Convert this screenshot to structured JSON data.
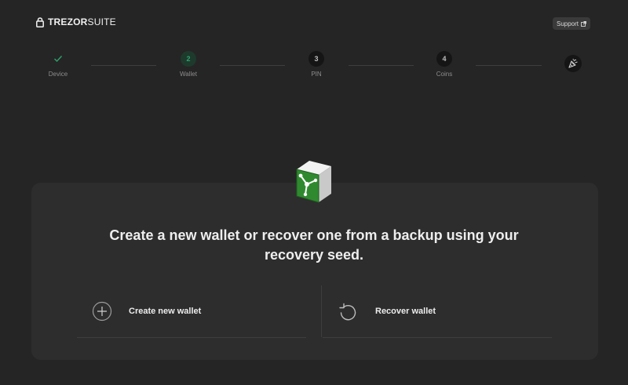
{
  "app": {
    "logo_bold": "TREZOR",
    "logo_light": "SUITE",
    "support_label": "Support"
  },
  "stepper": {
    "steps": [
      {
        "label": "Device",
        "number": "",
        "state": "done"
      },
      {
        "label": "Wallet",
        "number": "2",
        "state": "current"
      },
      {
        "label": "PIN",
        "number": "3",
        "state": "todo"
      },
      {
        "label": "Coins",
        "number": "4",
        "state": "todo"
      }
    ]
  },
  "main": {
    "headline": "Create a new wallet or recover one from a backup using your recovery seed.",
    "options": [
      {
        "label": "Create new wallet",
        "icon": "plus-circle-icon"
      },
      {
        "label": "Recover wallet",
        "icon": "recover-icon"
      }
    ]
  },
  "colors": {
    "background": "#252525",
    "card": "#2d2d2d",
    "accent": "#2ea26c",
    "hero_green": "#2f8a2f"
  }
}
